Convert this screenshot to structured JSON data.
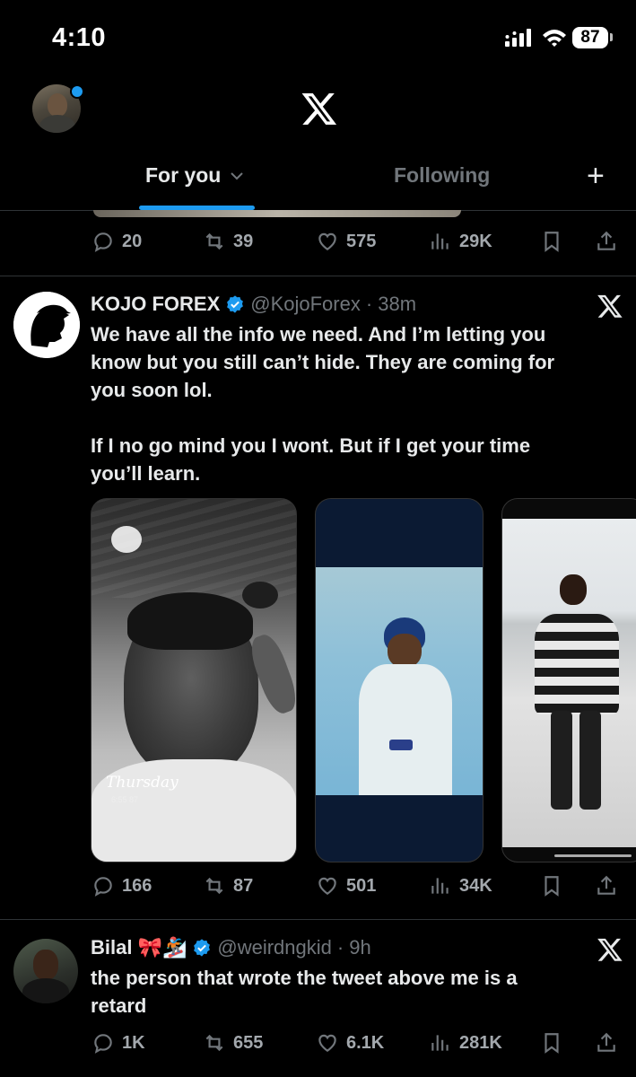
{
  "status_bar": {
    "time": "4:10",
    "battery": "87"
  },
  "header": {
    "logo_icon": "x-logo-icon"
  },
  "tabs": [
    {
      "label": "For you",
      "active": true
    },
    {
      "label": "Following",
      "active": false
    }
  ],
  "colors": {
    "accent": "#1d9bf0",
    "background": "#000000",
    "secondary_text": "#71767b"
  },
  "posts": [
    {
      "actions": {
        "replies": "20",
        "reposts": "39",
        "likes": "575",
        "views": "29K"
      }
    },
    {
      "name": "KOJO FOREX",
      "handle": "@KojoForex",
      "time": "· 38m",
      "text_1": "We have all the info we need. And I’m letting you",
      "text_2": "know but you still can’t hide. They are coming for",
      "text_3": "you soon lol.",
      "text_4": "If I no go mind you I wont. But if I get your time",
      "text_5": "you’ll learn.",
      "media_caption": "Thursday",
      "media_caption_time": "6:55 87",
      "actions": {
        "replies": "166",
        "reposts": "87",
        "likes": "501",
        "views": "34K"
      }
    },
    {
      "name": "Bilal 🎀🏂",
      "handle": "@weirdngkid",
      "time": "· 9h",
      "text_1": "the person that wrote the tweet above me is a",
      "text_2": "retard",
      "actions": {
        "replies": "1K",
        "reposts": "655",
        "likes": "6.1K",
        "views": "281K"
      }
    }
  ]
}
